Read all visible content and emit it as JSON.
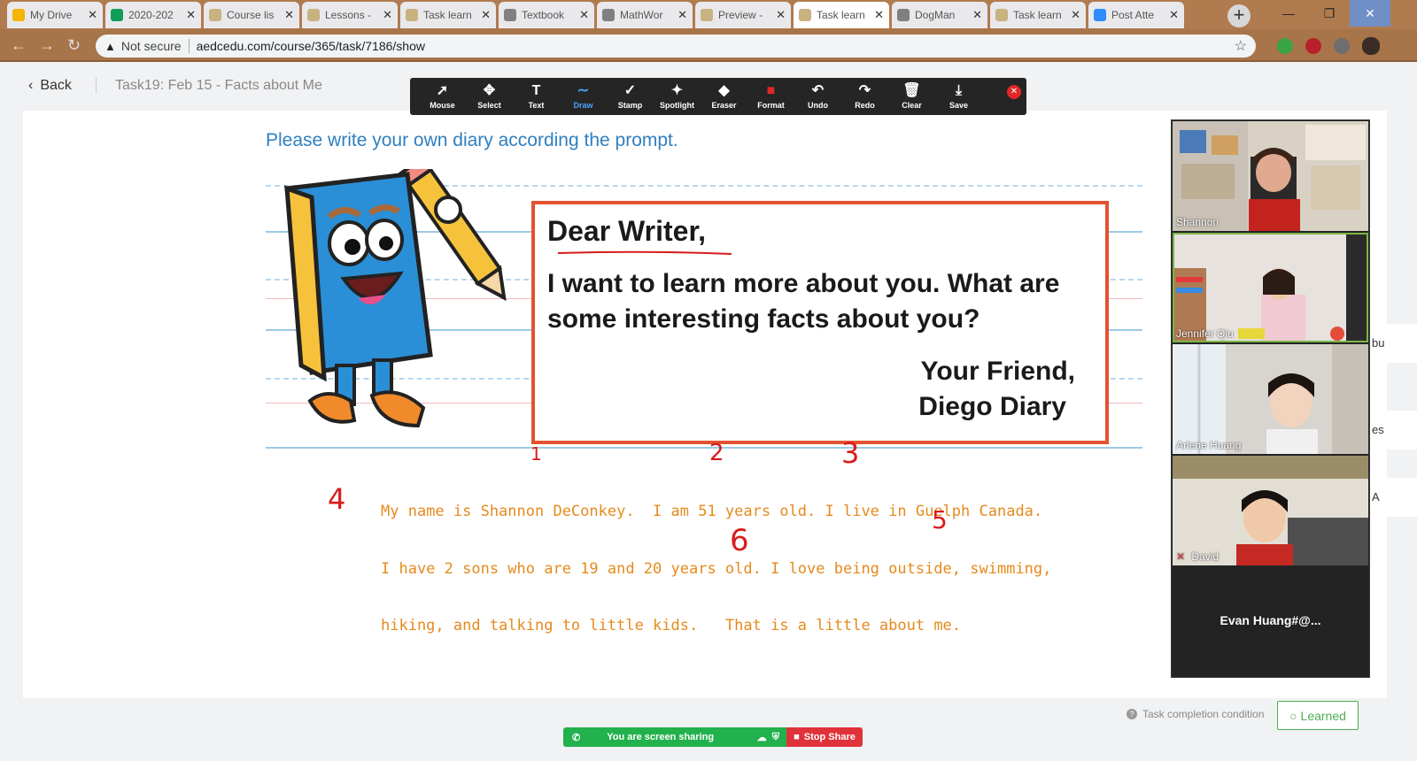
{
  "browser": {
    "tabs": [
      {
        "title": "My Drive",
        "color": "#f4b400"
      },
      {
        "title": "2020-202",
        "color": "#0f9d58"
      },
      {
        "title": "Course lis",
        "color": "#c8b280"
      },
      {
        "title": "Lessons -",
        "color": "#c8b280"
      },
      {
        "title": "Task learn",
        "color": "#c8b280"
      },
      {
        "title": "Textbook",
        "color": "#808080"
      },
      {
        "title": "MathWor",
        "color": "#808080"
      },
      {
        "title": "Preview -",
        "color": "#c8b280"
      },
      {
        "title": "Task learn",
        "color": "#c8b280",
        "active": true
      },
      {
        "title": "DogMan",
        "color": "#808080"
      },
      {
        "title": "Task learn",
        "color": "#c8b280"
      },
      {
        "title": "Post Atte",
        "color": "#2d8cff"
      }
    ],
    "not_secure": "Not secure",
    "url": "aedcedu.com/course/365/task/7186/show"
  },
  "page": {
    "back_label": "Back",
    "task_title": "Task19:  Feb 15 - Facts about Me",
    "prompt": "Please write your own diary according the prompt.",
    "letter": {
      "greeting": "Dear Writer,",
      "body": "I want to learn more about you. What are some interesting facts about you?",
      "sign_line1": "Your Friend,",
      "sign_line2": "Diego Diary"
    },
    "answer_lines": [
      "My name is Shannon DeConkey.  I am 51 years old. I live in Guelph Canada.",
      "I have 2 sons who are 19 and 20 years old. I love being outside, swimming,",
      "hiking, and talking to little kids.   That is a little about me."
    ],
    "annotations": [
      "1",
      "2",
      "3",
      "4",
      "5",
      "6"
    ],
    "completion_label": "Task completion condition",
    "learned_label": "Learned",
    "accent_color": "#e58a1d",
    "annotation_color": "#d81b1b"
  },
  "annotate_toolbar": {
    "tools": [
      {
        "label": "Mouse",
        "icon": "mouse-pointer-icon",
        "glyph": "➚"
      },
      {
        "label": "Select",
        "icon": "select-move-icon",
        "glyph": "✥"
      },
      {
        "label": "Text",
        "icon": "text-icon",
        "glyph": "T"
      },
      {
        "label": "Draw",
        "icon": "draw-squiggle-icon",
        "glyph": "∼",
        "active": true
      },
      {
        "label": "Stamp",
        "icon": "stamp-check-icon",
        "glyph": "✓"
      },
      {
        "label": "Spotlight",
        "icon": "spotlight-wand-icon",
        "glyph": "✦"
      },
      {
        "label": "Eraser",
        "icon": "eraser-icon",
        "glyph": "◆"
      },
      {
        "label": "Format",
        "icon": "format-color-icon",
        "glyph": "■"
      },
      {
        "label": "Undo",
        "icon": "undo-icon",
        "glyph": "↶"
      },
      {
        "label": "Redo",
        "icon": "redo-icon",
        "glyph": "↷"
      },
      {
        "label": "Clear",
        "icon": "trash-icon",
        "glyph": "🗑"
      },
      {
        "label": "Save",
        "icon": "save-download-icon",
        "glyph": "⤓"
      }
    ]
  },
  "video_panel": {
    "participants": [
      {
        "name": "Shannon"
      },
      {
        "name": "Jennifer Qiu"
      },
      {
        "name": "Arlene Huang"
      },
      {
        "name": "David",
        "muted": true
      }
    ],
    "no_video_name": "Evan  Huang#@..."
  },
  "side_clips": [
    "bu",
    "es",
    "A"
  ],
  "share_bar": {
    "status": "You are screen sharing",
    "stop_label": "Stop Share"
  }
}
